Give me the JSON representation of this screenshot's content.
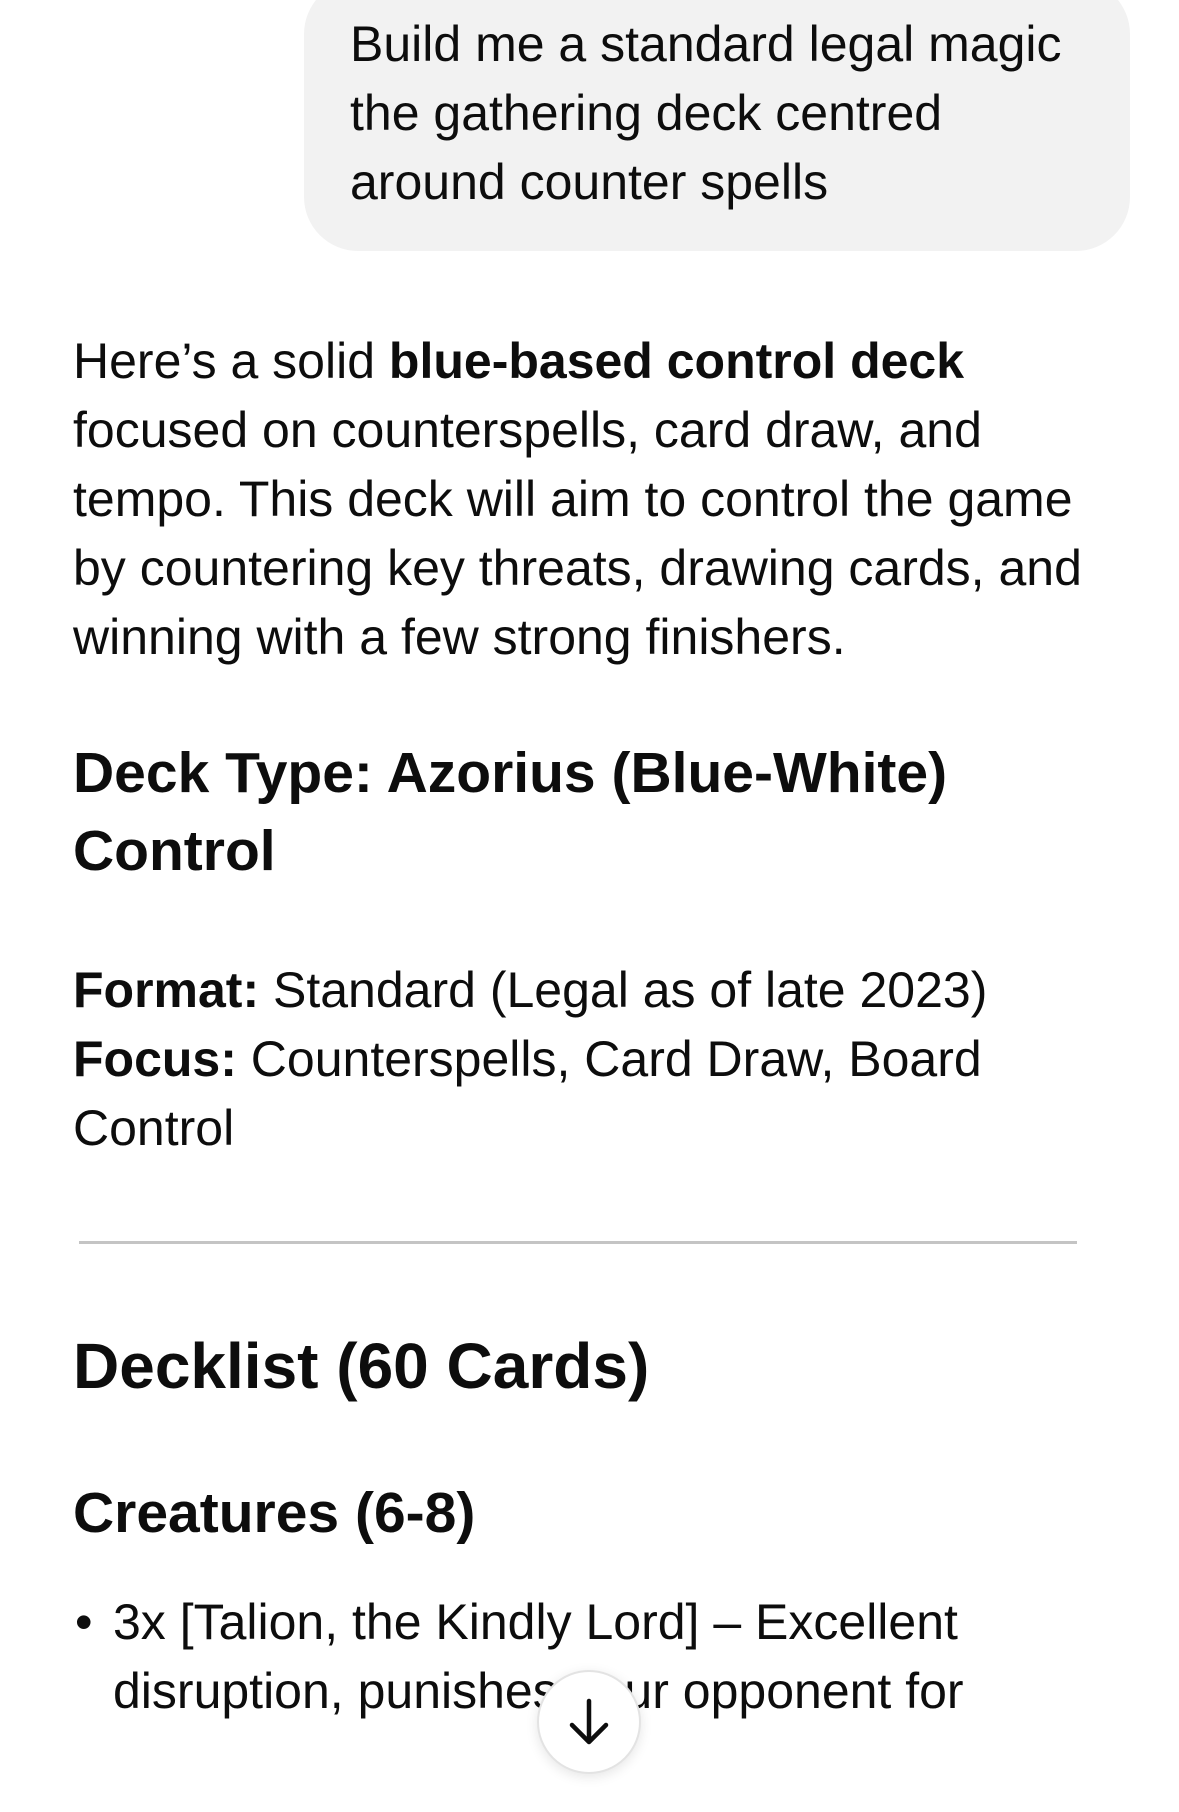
{
  "user_message": {
    "text": "Build me a standard legal magic the gathering deck centred around counter spells"
  },
  "response": {
    "intro_prefix": "Here’s a solid ",
    "intro_bold": "blue-based control deck",
    "intro_suffix": " focused on counterspells, card draw, and tempo. This deck will aim to control the game by countering key threats, drawing cards, and winning with a few strong finishers.",
    "deck_type_heading": "Deck Type: Azorius (Blue-White) Control",
    "format_label": "Format:",
    "format_value": " Standard (Legal as of late 2023)",
    "focus_label": "Focus:",
    "focus_value": " Counterspells, Card Draw, Board Control",
    "decklist_heading": "Decklist (60 Cards)",
    "creatures_heading": "Creatures (6-8)",
    "creatures": [
      {
        "bullet": "•",
        "text": "3x [Talion, the Kindly Lord] – Excellent disruption, punishes your opponent for"
      }
    ]
  },
  "scroll_button": {
    "icon": "arrow-down-icon"
  }
}
